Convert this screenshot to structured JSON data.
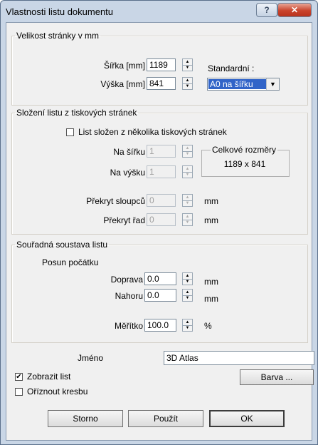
{
  "window": {
    "title": "Vlastnosti listu dokumentu",
    "help_label": "?",
    "close_label": "✕"
  },
  "page_size": {
    "legend": "Velikost stránky v mm",
    "width_label": "Šířka [mm]",
    "width_value": "1189",
    "height_label": "Výška [mm]",
    "height_value": "841",
    "standard_label": "Standardní :",
    "standard_selected": "A0 na šířku",
    "arrow_icon": "▼"
  },
  "composition": {
    "legend": "Složení listu z tiskových stránek",
    "multi_page_label": "List složen z několika tiskových stránek",
    "across_label": "Na šířku",
    "across_value": "1",
    "down_label": "Na výšku",
    "down_value": "1",
    "total_legend": "Celkové rozměry",
    "total_value": "1189 x 841",
    "col_overlap_label": "Překryt sloupců",
    "col_overlap_value": "0",
    "col_overlap_unit": "mm",
    "row_overlap_label": "Překryt řad",
    "row_overlap_value": "0",
    "row_overlap_unit": "mm"
  },
  "coords": {
    "legend": "Souřadná soustava listu",
    "origin_label": "Posun počátku",
    "right_label": "Doprava",
    "right_value": "0.0",
    "right_unit": "mm",
    "up_label": "Nahoru",
    "up_value": "0.0",
    "up_unit": "mm",
    "scale_label": "Měřítko",
    "scale_value": "100.0",
    "scale_unit": "%"
  },
  "name": {
    "label": "Jméno",
    "value": "3D Atlas"
  },
  "options": {
    "show_label": "Zobrazit list",
    "show_checked": "✔",
    "clip_label": "Oříznout kresbu",
    "color_button": "Barva ..."
  },
  "buttons": {
    "cancel": "Storno",
    "apply": "Použít",
    "ok": "OK"
  },
  "spin_icons": {
    "up": "▲",
    "down": "▼"
  }
}
